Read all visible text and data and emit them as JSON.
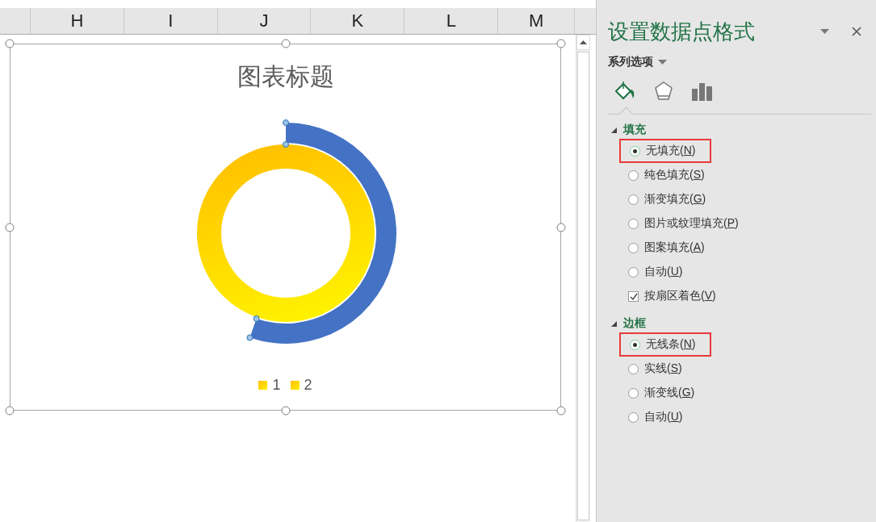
{
  "sheet": {
    "columns": [
      {
        "label": "H"
      },
      {
        "label": "I"
      },
      {
        "label": "J"
      },
      {
        "label": "K"
      },
      {
        "label": "L"
      },
      {
        "label": "M"
      }
    ]
  },
  "chart": {
    "title": "图表标题",
    "legend": [
      {
        "label": "1"
      },
      {
        "label": "2"
      }
    ]
  },
  "panel": {
    "title": "设置数据点格式",
    "options_menu": "系列选项",
    "tabs": [
      {
        "kind": "fill",
        "selected": true
      },
      {
        "kind": "effects",
        "selected": false
      },
      {
        "kind": "series",
        "selected": false
      }
    ],
    "sections": [
      {
        "title": "填充",
        "expanded": true,
        "options": [
          {
            "kind": "radio",
            "label": "无填充(",
            "mnemonic": "N",
            "suffix": ")",
            "selected": true,
            "highlighted": true
          },
          {
            "kind": "radio",
            "label": "纯色填充(",
            "mnemonic": "S",
            "suffix": ")",
            "selected": false,
            "highlighted": false
          },
          {
            "kind": "radio",
            "label": "渐变填充(",
            "mnemonic": "G",
            "suffix": ")",
            "selected": false,
            "highlighted": false
          },
          {
            "kind": "radio",
            "label": "图片或纹理填充(",
            "mnemonic": "P",
            "suffix": ")",
            "selected": false,
            "highlighted": false
          },
          {
            "kind": "radio",
            "label": "图案填充(",
            "mnemonic": "A",
            "suffix": ")",
            "selected": false,
            "highlighted": false
          },
          {
            "kind": "radio",
            "label": "自动(",
            "mnemonic": "U",
            "suffix": ")",
            "selected": false,
            "highlighted": false
          },
          {
            "kind": "checkbox",
            "label": "按扇区着色(",
            "mnemonic": "V",
            "suffix": ")",
            "checked": true,
            "highlighted": false
          }
        ]
      },
      {
        "title": "边框",
        "expanded": true,
        "options": [
          {
            "kind": "radio",
            "label": "无线条(",
            "mnemonic": "N",
            "suffix": ")",
            "selected": true,
            "highlighted": true
          },
          {
            "kind": "radio",
            "label": "实线(",
            "mnemonic": "S",
            "suffix": ")",
            "selected": false,
            "highlighted": false
          },
          {
            "kind": "radio",
            "label": "渐变线(",
            "mnemonic": "G",
            "suffix": ")",
            "selected": false,
            "highlighted": false
          },
          {
            "kind": "radio",
            "label": "自动(",
            "mnemonic": "U",
            "suffix": ")",
            "selected": false,
            "highlighted": false
          }
        ]
      }
    ]
  }
}
